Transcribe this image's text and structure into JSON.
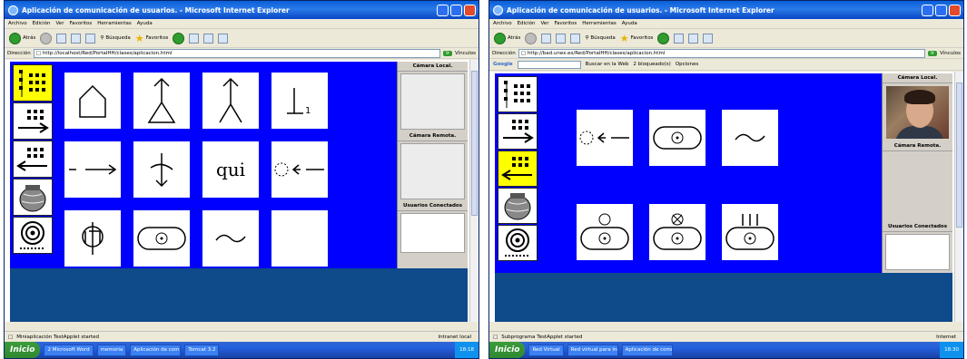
{
  "shot_left": {
    "window_title": "Aplicación de comunicación de usuarios. - Microsoft Internet Explorer",
    "menu": [
      "Archivo",
      "Edición",
      "Ver",
      "Favoritos",
      "Herramientas",
      "Ayuda"
    ],
    "toolbar": {
      "back": "Atrás",
      "search": "Búsqueda",
      "favorites": "Favoritos"
    },
    "address_label": "Dirección",
    "address_url": "http://localhost/Red/PortalHH/clases/aplicacion.html",
    "go_label": "Ir",
    "links_label": "Vínculos",
    "grid_text": [
      "",
      "",
      "",
      "",
      "",
      "",
      "qui",
      "",
      "",
      "",
      "",
      ""
    ],
    "right_panel": {
      "local_camera": "Cámara Local.",
      "remote_camera": "Cámara Remota.",
      "connected_users": "Usuarios Conectados"
    },
    "status_text": "Miniaplicación TestApplet started",
    "status_zone": "Intranet local",
    "taskbar": {
      "start": "Inicio",
      "tasks": [
        "2 Microsoft Word",
        "memoria",
        "Aplicación de comuni...",
        "Tomcat 3.2"
      ],
      "clock": "18:18"
    }
  },
  "shot_right": {
    "window_title": "Aplicación de comunicación de usuarios. - Microsoft Internet Explorer",
    "menu": [
      "Archivo",
      "Edición",
      "Ver",
      "Favoritos",
      "Herramientas",
      "Ayuda"
    ],
    "toolbar": {
      "back": "Atrás",
      "search": "Búsqueda",
      "favorites": "Favoritos"
    },
    "address_label": "Dirección",
    "address_url": "http://bad.unex.es/Red/PortalHH/clases/aplicacion.html",
    "go_label": "Ir",
    "links_label": "Vínculos",
    "google": {
      "logo": "Google",
      "search_button": "Buscar en la Web",
      "blocked": "2 bloqueado(s)",
      "options": "Opciones"
    },
    "right_panel": {
      "local_camera": "Cámara Local.",
      "remote_camera": "Cámara Remota.",
      "connected_users": "Usuarios Conectados"
    },
    "status_text": "Subprograma TestApplet started",
    "status_zone": "Internet",
    "taskbar": {
      "start": "Inicio",
      "tasks": [
        "Red Virtual",
        "Red virtual para inco...",
        "Aplicación de comuni..."
      ],
      "clock": "18:30"
    }
  },
  "colors": {
    "applet_bg": "#0000ff",
    "band": "#0f4a8a",
    "selected_button": "#ffff00",
    "xp_blue": "#245edb"
  }
}
